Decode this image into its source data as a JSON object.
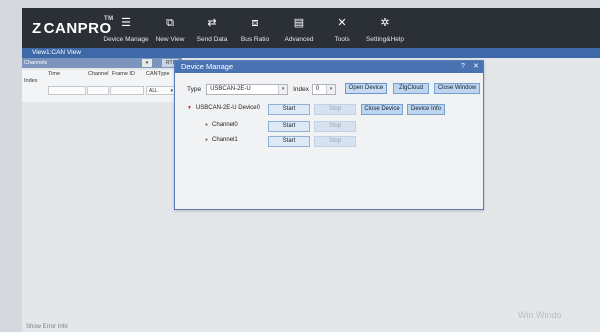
{
  "app": {
    "logo": "CANPRO",
    "logo_prefix": "Z",
    "logo_tm": "TM"
  },
  "toolbar": [
    {
      "label": "Device Manage",
      "icon": "device-manage-icon",
      "glyph": "☰"
    },
    {
      "label": "New View",
      "icon": "new-view-icon",
      "glyph": "⧉"
    },
    {
      "label": "Send Data",
      "icon": "send-data-icon",
      "glyph": "⇄"
    },
    {
      "label": "Bus Ratio",
      "icon": "bus-ratio-icon",
      "glyph": "⧈"
    },
    {
      "label": "Advanced",
      "icon": "advanced-icon",
      "glyph": "▤"
    },
    {
      "label": "Tools",
      "icon": "tools-icon",
      "glyph": "✕"
    },
    {
      "label": "Setting&Help",
      "icon": "settings-icon",
      "glyph": "✲"
    }
  ],
  "view": {
    "title": "View1:CAN View",
    "channels_label": "Channels",
    "channels_drop": "▾",
    "rt_label": "RTI"
  },
  "grid": {
    "index_label": "Index",
    "columns": [
      "Time",
      "Channel",
      "Frame ID",
      "CANType"
    ],
    "cantype_value": "ALL",
    "cantype_arrow": "▾"
  },
  "status": {
    "text": "Show Error Info"
  },
  "watermark": "Win Windo",
  "dialog": {
    "title": "Device Manage",
    "help": "?",
    "close": "✕",
    "type_label": "Type",
    "type_value": "USBCAN-2E-U",
    "type_arrow": "▾",
    "index_label": "Index",
    "index_value": "0",
    "index_arrow": "▾",
    "buttons": {
      "open_device": "Open Device",
      "zlg_cloud": "ZlgCloud",
      "close_window": "Close Window",
      "close_device": "Close Device",
      "device_info": "Device Info"
    },
    "device": {
      "name": "USBCAN-2E-U Device0",
      "start": "Start",
      "stop": "Stop"
    },
    "channels": [
      {
        "name": "Channel0",
        "start": "Start",
        "stop": "Stop"
      },
      {
        "name": "Channel1",
        "start": "Start",
        "stop": "Stop"
      }
    ]
  }
}
